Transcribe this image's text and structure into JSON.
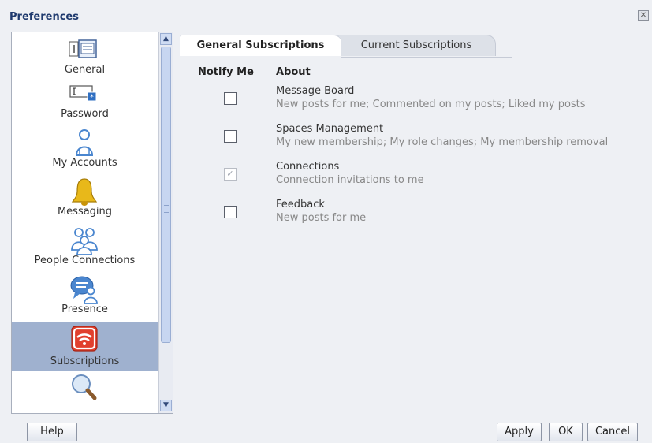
{
  "dialog": {
    "title": "Preferences",
    "close_glyph": "✕"
  },
  "nav": {
    "items": [
      {
        "label": "General",
        "icon": "general-settings-icon"
      },
      {
        "label": "Password",
        "icon": "password-icon"
      },
      {
        "label": "My Accounts",
        "icon": "person-icon"
      },
      {
        "label": "Messaging",
        "icon": "bell-icon"
      },
      {
        "label": "People Connections",
        "icon": "people-icon"
      },
      {
        "label": "Presence",
        "icon": "presence-icon"
      },
      {
        "label": "Subscriptions",
        "icon": "subscriptions-icon",
        "selected": true
      },
      {
        "label": "",
        "icon": "search-icon"
      }
    ],
    "scroll_up": "▲",
    "scroll_down": "▼",
    "selected_color": "#9fb1cf"
  },
  "tabs": {
    "general": "General Subscriptions",
    "current": "Current Subscriptions"
  },
  "table": {
    "col_notify": "Notify Me",
    "col_about": "About",
    "rows": [
      {
        "name": "Message Board",
        "desc": "New posts for me; Commented on my posts; Liked my posts",
        "checked": false
      },
      {
        "name": "Spaces Management",
        "desc": "My new membership; My role changes; My membership removal",
        "checked": false
      },
      {
        "name": "Connections",
        "desc": "Connection invitations to me",
        "checked": true,
        "disabled": true
      },
      {
        "name": "Feedback",
        "desc": "New posts for me",
        "checked": false
      }
    ],
    "check_glyph": "✓"
  },
  "buttons": {
    "help": "Help",
    "apply": "Apply",
    "ok": "OK",
    "cancel": "Cancel"
  }
}
